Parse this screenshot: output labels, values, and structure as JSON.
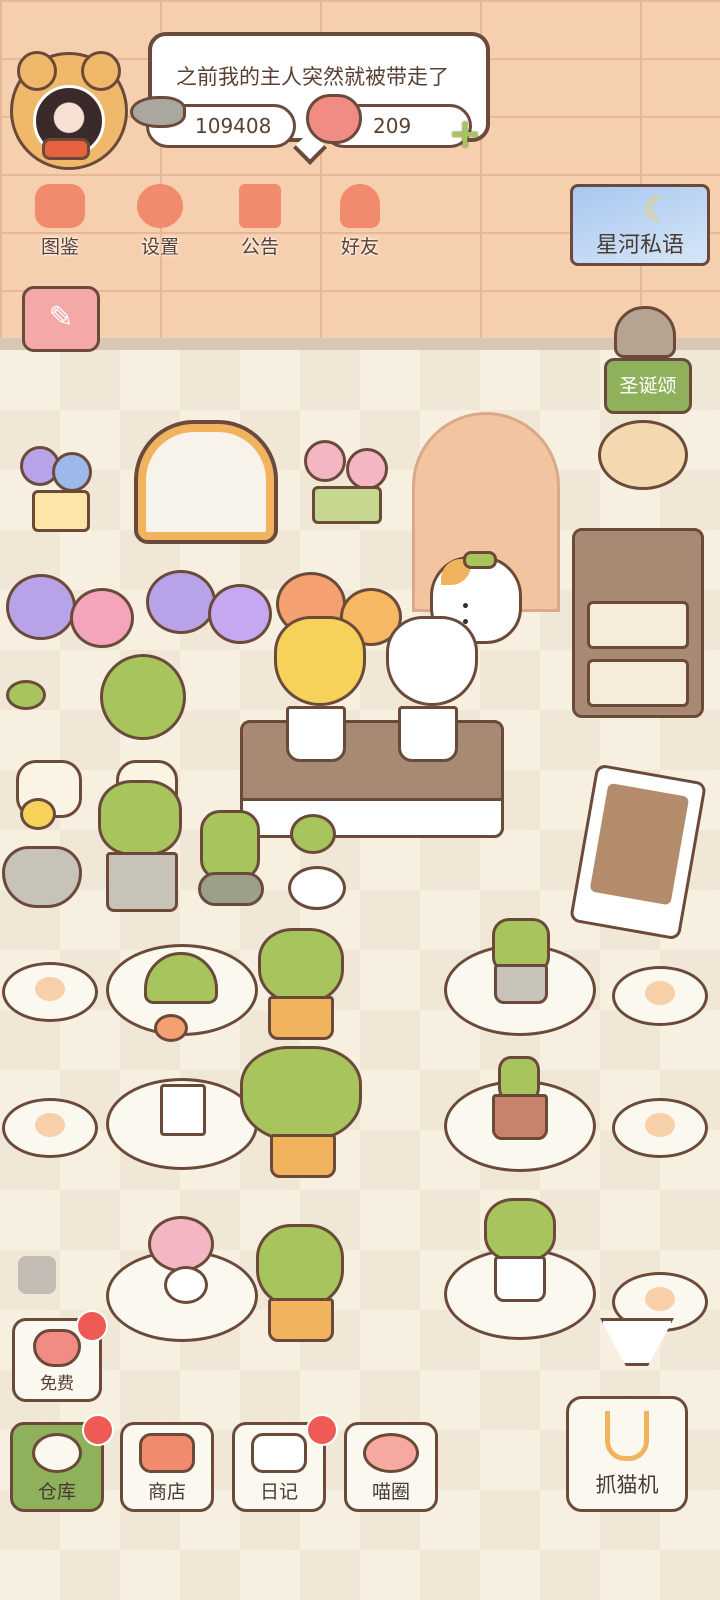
{
  "speech": {
    "text": "之前我的主人突然就被带走了"
  },
  "currency": {
    "fish": "109408",
    "hearts": "209",
    "add": "+"
  },
  "menu": {
    "catalog": "图鉴",
    "settings": "设置",
    "notice": "公告",
    "friends": "好友"
  },
  "events": {
    "galaxy": "星河私语",
    "christmas": "圣诞颂"
  },
  "bottom": {
    "free": "免费",
    "warehouse": "仓库",
    "shop": "商店",
    "diary": "日记",
    "circle": "喵圈",
    "claw_machine": "抓猫机"
  },
  "colors": {
    "wall": "#f5cfae",
    "floor": "#f7f0e1",
    "accent": "#f28a6d",
    "leaf": "#a7c55c",
    "outline": "#6b4a3a",
    "badge": "#ef5a55"
  }
}
